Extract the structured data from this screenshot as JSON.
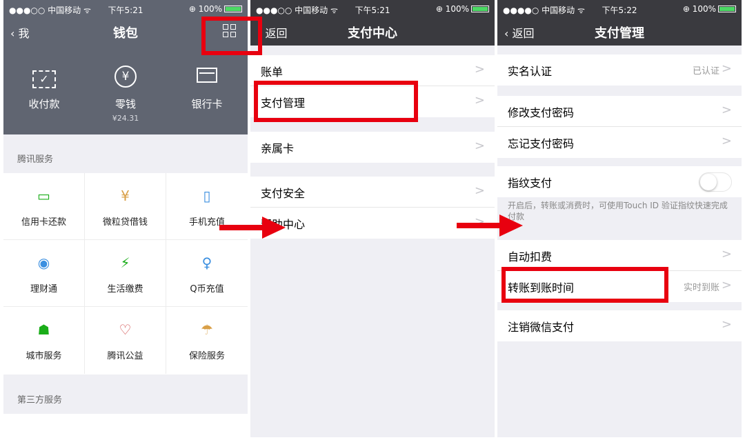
{
  "colors": {
    "header_bg": "#606571",
    "nav_bg": "#3a3a3f",
    "accent_green": "#1aad19",
    "highlight_red": "#e8000f"
  },
  "status_bar": [
    {
      "carrier": "●●●○○ 中国移动 ᯤ",
      "time": "下午5:21",
      "battery": "⊕ 100%"
    },
    {
      "carrier": "●●●○○ 中国移动 ᯤ",
      "time": "下午5:21",
      "battery": "⊕ 100%"
    },
    {
      "carrier": "●●●●○ 中国移动 ᯤ",
      "time": "下午5:22",
      "battery": "⊕ 100%"
    }
  ],
  "wallet": {
    "back_label": "我",
    "title": "钱包",
    "top_actions": [
      {
        "label": "收付款",
        "icon": "scan-icon"
      },
      {
        "label": "零钱",
        "sub": "¥24.31",
        "icon": "yuan-icon"
      },
      {
        "label": "银行卡",
        "icon": "card-icon"
      }
    ],
    "tencent_section": "腾讯服务",
    "services": [
      {
        "label": "信用卡还款",
        "icon": "credit-card-icon",
        "glyph": "▭"
      },
      {
        "label": "微粒贷借钱",
        "icon": "loan-icon",
        "glyph": "¥"
      },
      {
        "label": "手机充值",
        "icon": "phone-icon",
        "glyph": "▯"
      },
      {
        "label": "理财通",
        "icon": "wealth-icon",
        "glyph": "◉"
      },
      {
        "label": "生活缴费",
        "icon": "bolt-icon",
        "glyph": "⚡"
      },
      {
        "label": "Q币充值",
        "icon": "penguin-icon",
        "glyph": "♀"
      },
      {
        "label": "城市服务",
        "icon": "city-icon",
        "glyph": "☗"
      },
      {
        "label": "腾讯公益",
        "icon": "heart-icon",
        "glyph": "♡"
      },
      {
        "label": "保险服务",
        "icon": "umbrella-icon",
        "glyph": "☂"
      }
    ],
    "third_party_section": "第三方服务"
  },
  "pay_center": {
    "back_label": "返回",
    "title": "支付中心",
    "groups": [
      [
        "账单",
        "支付管理"
      ],
      [
        "亲属卡"
      ],
      [
        "支付安全",
        "帮助中心"
      ]
    ]
  },
  "pay_manage": {
    "back_label": "返回",
    "title": "支付管理",
    "realname": {
      "label": "实名认证",
      "value": "已认证"
    },
    "password": [
      "修改支付密码",
      "忘记支付密码"
    ],
    "fingerprint": {
      "label": "指纹支付",
      "note": "开启后，转账或消费时，可使用Touch ID 验证指纹快速完成付款"
    },
    "payment": [
      {
        "label": "自动扣费",
        "value": ""
      },
      {
        "label": "转账到账时间",
        "value": "实时到账"
      }
    ],
    "deregister": "注销微信支付"
  },
  "chevron": ">"
}
